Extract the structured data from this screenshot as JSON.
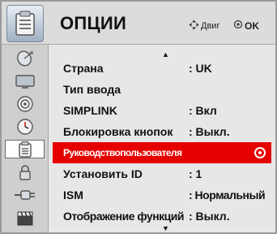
{
  "header": {
    "title": "ОПЦИИ",
    "hint_move": "Двиг",
    "hint_ok": "OK",
    "icon": "options-menu-icon"
  },
  "sidebar": {
    "categories": [
      {
        "icon": "satellite-dish-icon",
        "active": false
      },
      {
        "icon": "tv-screen-icon",
        "active": false
      },
      {
        "icon": "speaker-icon",
        "active": false
      },
      {
        "icon": "clock-icon",
        "active": false
      },
      {
        "icon": "options-icon",
        "active": true
      },
      {
        "icon": "lock-icon",
        "active": false
      },
      {
        "icon": "input-plug-icon",
        "active": false
      },
      {
        "icon": "clapperboard-icon",
        "active": false
      }
    ]
  },
  "menu": {
    "items": [
      {
        "label": "Страна",
        "value": ": UK"
      },
      {
        "label": "Тип ввода",
        "value": ""
      },
      {
        "label": "SIMPLINK",
        "value": ": Вкл"
      },
      {
        "label": "Блокировка кнопок",
        "value": ": Выкл."
      },
      {
        "label": "Руководствопользователя",
        "value": "",
        "selected": true
      },
      {
        "label": "Установить ID",
        "value": ": 1"
      },
      {
        "label": "ISM",
        "value": ": Нормальный"
      },
      {
        "label": "Отображение функций",
        "value": ": Выкл."
      }
    ]
  },
  "colors": {
    "selection": "#e60000",
    "background": "#e7e7e7",
    "header": "#dcdcdc",
    "text": "#111111"
  }
}
